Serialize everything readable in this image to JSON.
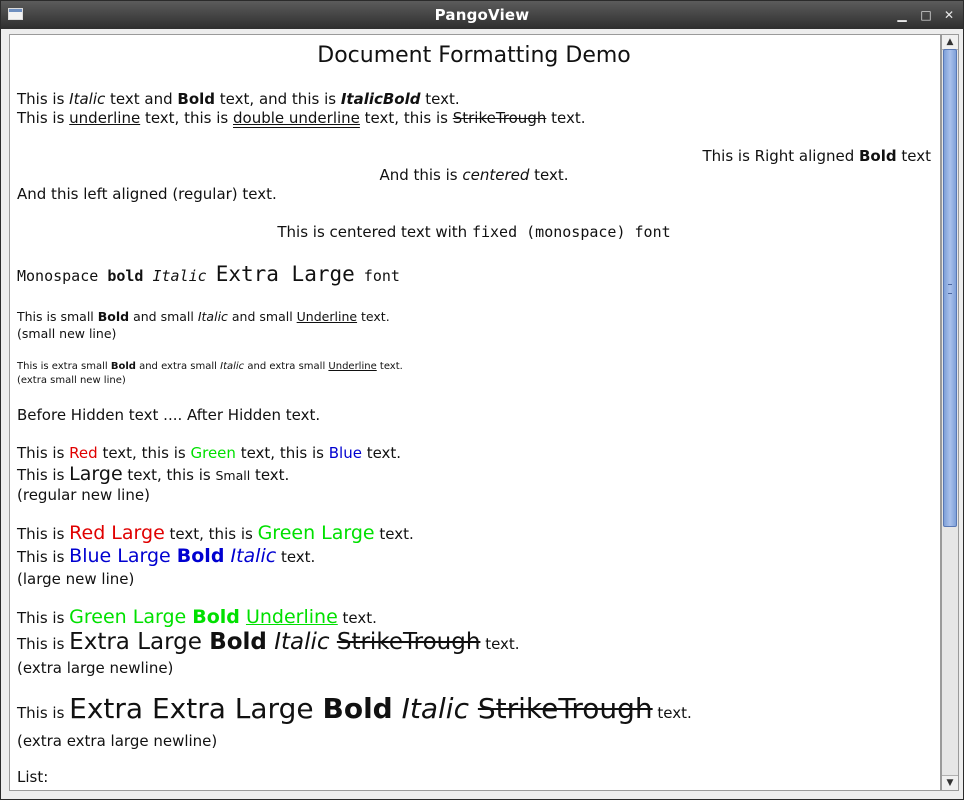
{
  "window": {
    "title": "PangoView",
    "controls": {
      "minimize": "▁",
      "maximize": "□",
      "close": "✕"
    }
  },
  "doc": {
    "heading": "Document Formatting Demo",
    "l1": {
      "a": "This is ",
      "b": "Italic",
      "c": " text and  ",
      "d": "Bold",
      "e": "  text, and this is  ",
      "f": "ItalicBold",
      "g": "  text."
    },
    "l2": {
      "a": "This is ",
      "b": "underline",
      "c": " text, this is ",
      "d": "double underline",
      "e": " text, this is ",
      "f": "StrikeTrough",
      "g": " text."
    },
    "right": {
      "a": "This is Right aligned ",
      "b": "Bold",
      "c": " text"
    },
    "centered": {
      "a": "And this is ",
      "b": "centered",
      "c": " text."
    },
    "left": "And this left aligned (regular) text.",
    "mono_center": {
      "a": "This is centered text with ",
      "b": "fixed (monospace) font"
    },
    "mono_line": {
      "a": "Monospace ",
      "b": "bold",
      "c": " ",
      "d": "Italic",
      "e": " ",
      "f": "Extra Large",
      "g": " font"
    },
    "small": {
      "a": "This is small ",
      "b": "Bold",
      "c": " and small ",
      "d": "Italic",
      "e": " and small ",
      "f": "Underline",
      "g": " text.",
      "nl": "(small new line)"
    },
    "xsmall": {
      "a": "This is extra small ",
      "b": "Bold",
      "c": " and extra small ",
      "d": "Italic",
      "e": " and extra small ",
      "f": "Underline",
      "g": " text.",
      "nl": "(extra small new line)"
    },
    "hidden": "Before Hidden text .... After Hidden text.",
    "colors": {
      "a": "This is ",
      "b": "Red",
      "c": " text, this is ",
      "d": "Green",
      "e": " text, this is ",
      "f": "Blue",
      "g": " text."
    },
    "sizes": {
      "a": "This is  ",
      "b": "Large",
      "c": "  text, this is ",
      "d": "Small",
      "e": " text.",
      "nl": "(regular new line)"
    },
    "large1": {
      "a": "This is  ",
      "b": "Red Large",
      "c": " text, this is ",
      "d": "Green Large",
      "e": " text."
    },
    "large2": {
      "a": "This is ",
      "b": "Blue Large ",
      "c": "Bold",
      "d": " ",
      "e": "Italic",
      "f": "  text.",
      "nl": "(large new line)"
    },
    "xl1": {
      "a": "This is  ",
      "b": "Green Large ",
      "c": "Bold",
      "d": " ",
      "e": "Underline",
      "f": "  text."
    },
    "xl2": {
      "a": "This is  ",
      "b": "Extra Large ",
      "c": "Bold",
      "d": " ",
      "e": "Italic",
      "f": " ",
      "g": "StrikeTrough",
      "h": "  text.",
      "nl": "(extra large newline)"
    },
    "xxl": {
      "a": "This is  ",
      "b": "Extra Extra Large ",
      "c": "Bold",
      "d": " ",
      "e": "Italic",
      "f": " ",
      "g": "StrikeTrough",
      "h": "  text.",
      "nl": "(extra extra large newline)"
    },
    "list": "List:"
  },
  "colors": {
    "red": "#e00000",
    "green": "#00e000",
    "blue": "#0000d0",
    "thumb": "#8fadde"
  },
  "scrollbar": {
    "up": "▲",
    "down": "▼"
  }
}
